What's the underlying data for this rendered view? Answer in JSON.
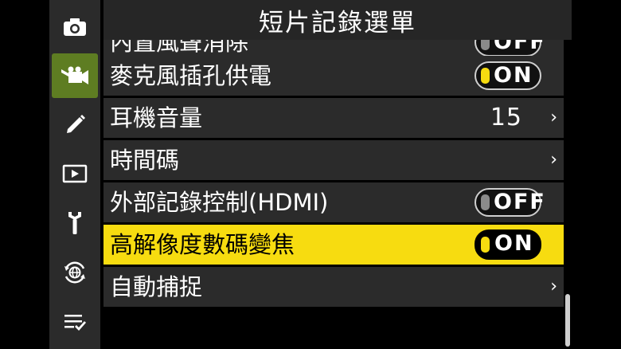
{
  "header": {
    "title": "短片記錄選單"
  },
  "sidebar": {
    "items": [
      {
        "name": "camera-icon"
      },
      {
        "name": "movie-camera-icon",
        "active": true
      },
      {
        "name": "pencil-icon"
      },
      {
        "name": "playback-icon"
      },
      {
        "name": "wrench-icon"
      },
      {
        "name": "network-icon"
      },
      {
        "name": "my-menu-icon"
      }
    ]
  },
  "menu": {
    "items": [
      {
        "label": "內置風聲消除",
        "control": "toggle",
        "value": "OFF"
      },
      {
        "label": "麥克風插孔供電",
        "control": "toggle",
        "value": "ON"
      },
      {
        "label": "耳機音量",
        "control": "value",
        "value": "15",
        "chevron": "›"
      },
      {
        "label": "時間碼",
        "control": "chevron",
        "chevron": "›"
      },
      {
        "label": "外部記錄控制(HDMI)",
        "control": "toggle",
        "value": "OFF"
      },
      {
        "label": "高解像度數碼變焦",
        "control": "toggle",
        "value": "ON",
        "selected": true
      },
      {
        "label": "自動捕捉",
        "control": "chevron",
        "chevron": "›"
      }
    ]
  },
  "colors": {
    "highlight": "#f7dc10",
    "active_tab": "#5e7d22",
    "row_bg": "#2b2b2b"
  }
}
